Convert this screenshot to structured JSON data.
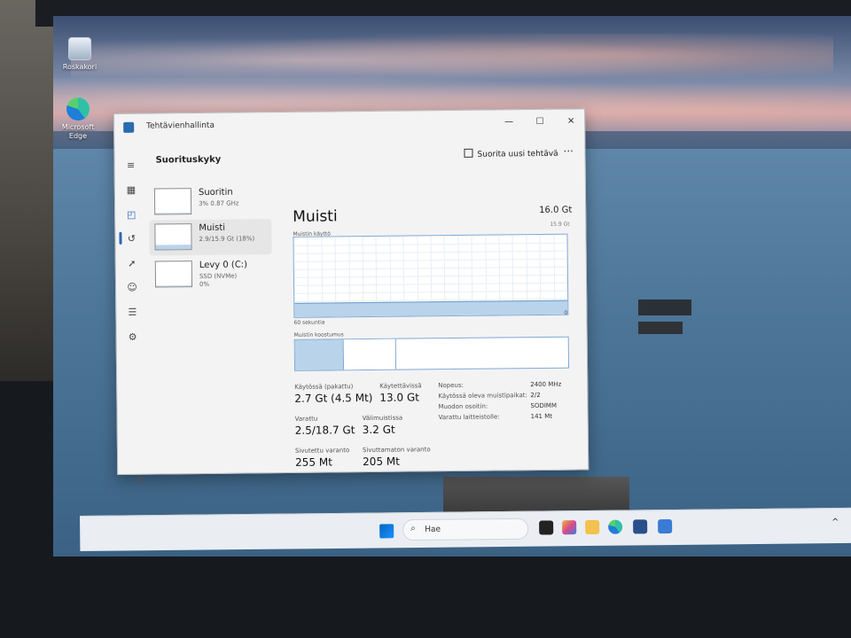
{
  "desktop": {
    "recycle_bin_label": "Roskakori",
    "edge_label": "Microsoft Edge"
  },
  "window": {
    "title": "Tehtävienhallinta",
    "controls": {
      "minimize": "—",
      "maximize": "☐",
      "close": "✕"
    }
  },
  "header": {
    "section_title": "Suorituskyky",
    "run_new_task": "Suorita uusi tehtävä",
    "more": "···"
  },
  "nav_icons": [
    "menu-icon",
    "processes-icon",
    "performance-icon",
    "history-icon",
    "startup-icon",
    "users-icon",
    "details-icon",
    "services-icon",
    "settings-icon"
  ],
  "devices": [
    {
      "name": "Suoritin",
      "sub": "3% 0.87 GHz",
      "sub2": "",
      "level": 0.03
    },
    {
      "name": "Muisti",
      "sub": "2.9/15.9 Gt (18%)",
      "sub2": "",
      "level": 0.18
    },
    {
      "name": "Levy 0 (C:)",
      "sub": "SSD (NVMe)",
      "sub2": "0%",
      "level": 0.0
    }
  ],
  "memory": {
    "title": "Muisti",
    "total": "16.0 Gt",
    "usage_label": "Muistin käyttö",
    "usage_max": "15.9 Gt",
    "usage_level": 0.18,
    "axis_left": "60 sekuntia",
    "axis_right": "0",
    "composition_label": "Muistin koostumus",
    "composition_in_use": 0.18,
    "composition_modified": 0.19
  },
  "stats": {
    "in_use_label": "Käytössä (pakattu)",
    "in_use_value": "2.7 Gt (4.5 Mt)",
    "available_label": "Käytettävissä",
    "available_value": "13.0 Gt",
    "committed_label": "Varattu",
    "committed_value": "2.5/18.7 Gt",
    "cached_label": "Välimuistissa",
    "cached_value": "3.2 Gt",
    "paged_label": "Sivutettu varanto",
    "paged_value": "255 Mt",
    "nonpaged_label": "Sivuttamaton varanto",
    "nonpaged_value": "205 Mt"
  },
  "details": [
    {
      "label": "Nopeus:",
      "value": "2400 MHz"
    },
    {
      "label": "Käytössä oleva muistipaikat:",
      "value": "2/2"
    },
    {
      "label": "Muodon osoitin:",
      "value": "SODIMM"
    },
    {
      "label": "Varattu laitteistolle:",
      "value": "141 Mt"
    }
  ],
  "taskbar": {
    "search_placeholder": "Hae",
    "apps": [
      "widgets-icon",
      "copilot-icon",
      "file-explorer-icon",
      "edge-icon",
      "store-icon",
      "task-manager-icon"
    ],
    "tray_chevron": "^"
  }
}
